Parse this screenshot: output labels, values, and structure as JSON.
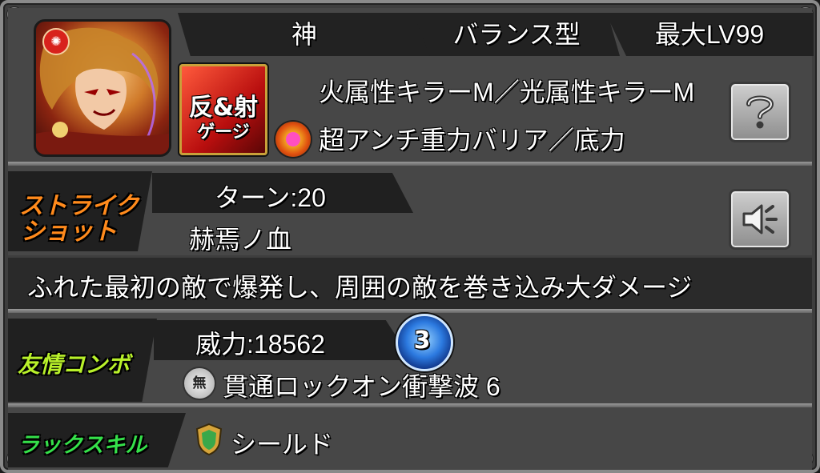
{
  "header": {
    "tab_race": "神",
    "tab_type": "バランス型",
    "tab_maxlv": "最大LV99"
  },
  "ability": {
    "line1": "火属性キラーM／光属性キラーM",
    "line2": "超アンチ重力バリア／底力",
    "gauge_badge_line1": "反&射",
    "gauge_badge_line2": "ゲージ"
  },
  "strike_shot": {
    "label_line1": "ストライク",
    "label_line2": "ショット",
    "turn": "ターン:20",
    "name": "赫焉ノ血",
    "description": "ふれた最初の敵で爆発し、周囲の敵を巻き込み大ダメージ"
  },
  "friendship_combo": {
    "label": "友情コンボ",
    "power": "威力:18562",
    "level_badge": "3",
    "element_icon_text": "無",
    "name": "貫通ロックオン衝撃波 6"
  },
  "luck_skill": {
    "label": "ラックスキル",
    "name": "シールド"
  },
  "colors": {
    "strike_label": "#ff8a1c",
    "friend_label": "#b8f02a",
    "luck_label": "#35e04a",
    "gauge_badge": "#d81e1e"
  },
  "icons": {
    "help": "question-icon",
    "voice": "speaker-icon"
  }
}
